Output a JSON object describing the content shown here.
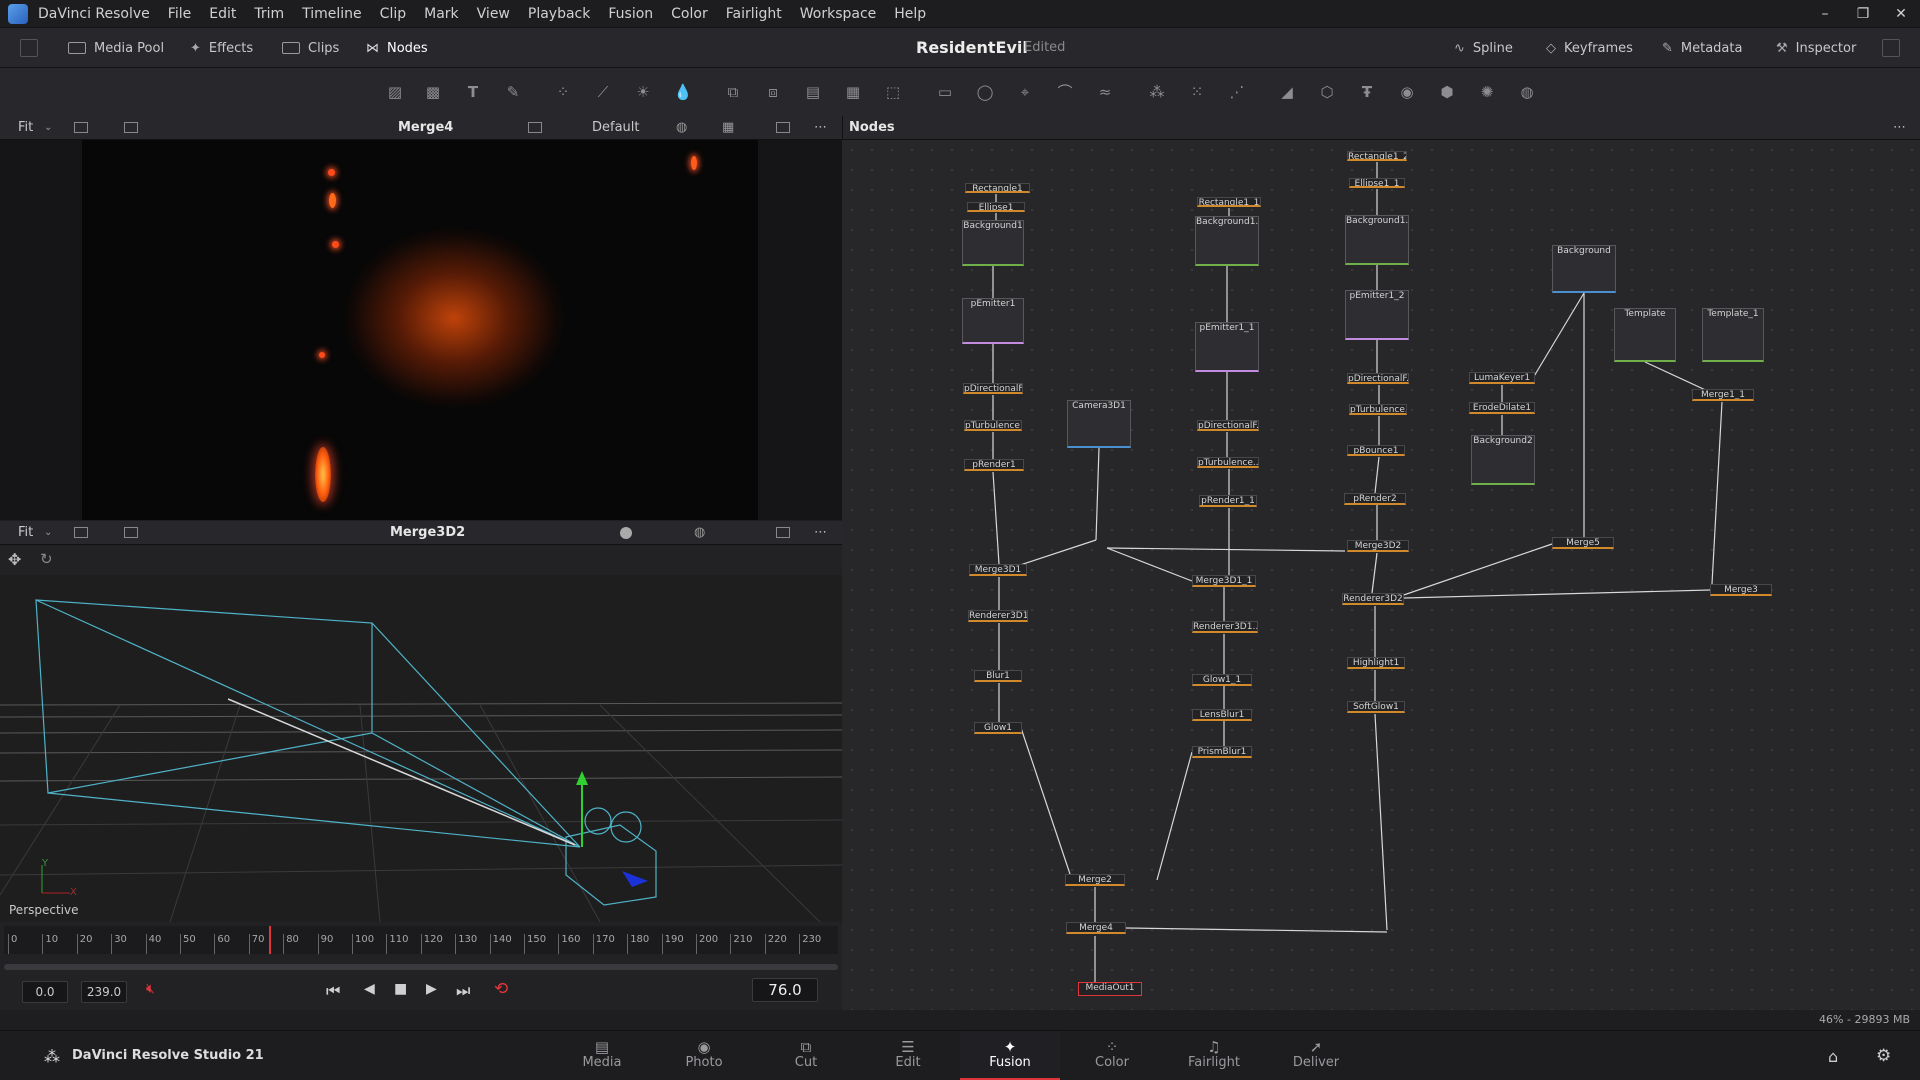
{
  "app": {
    "icon": "davinci-resolve-icon",
    "name": "DaVinci Resolve",
    "menus": [
      "File",
      "Edit",
      "Trim",
      "Timeline",
      "Clip",
      "Mark",
      "View",
      "Playback",
      "Fusion",
      "Color",
      "Fairlight",
      "Workspace",
      "Help"
    ]
  },
  "toolbar": {
    "left": [
      {
        "label": "Media Pool",
        "icon": "media-pool-icon"
      },
      {
        "label": "Effects",
        "icon": "effects-icon"
      },
      {
        "label": "Clips",
        "icon": "clips-icon"
      },
      {
        "label": "Nodes",
        "icon": "nodes-icon"
      }
    ],
    "project": "ResidentEvil",
    "status": "Edited",
    "right": [
      {
        "label": "Spline",
        "icon": "spline-icon"
      },
      {
        "label": "Keyframes",
        "icon": "keyframes-icon"
      },
      {
        "label": "Metadata",
        "icon": "metadata-icon"
      },
      {
        "label": "Inspector",
        "icon": "inspector-icon"
      }
    ]
  },
  "viewer1": {
    "zoom": "Fit",
    "title": "Merge4",
    "lut": "Default"
  },
  "viewer2": {
    "zoom": "Fit",
    "title": "Merge3D2",
    "mode": "Perspective",
    "axis_y": "Y",
    "axis_x": "X"
  },
  "nodes_panel": {
    "title": "Nodes",
    "memory": "46% - 29893 MB"
  },
  "node_list": [
    "Rectangle1",
    "Ellipse1",
    "Background1",
    "pEmitter1",
    "pDirectionalF...",
    "pTurbulence1",
    "pRender1",
    "Merge3D1",
    "Renderer3D1",
    "Blur1",
    "Glow1",
    "Camera3D1",
    "Rectangle1_1",
    "Background1...",
    "pEmitter1_1",
    "pDirectionalF...",
    "pTurbulence...",
    "pRender1_1",
    "Merge3D1_1",
    "Renderer3D1...",
    "Glow1_1",
    "LensBlur1",
    "PrismBlur1",
    "Rectangle1_2",
    "Ellipse1_1",
    "Background1...",
    "pEmitter1_2",
    "pDirectionalF...",
    "pTurbulence...",
    "pBounce1",
    "pRender2",
    "Merge3D2",
    "Renderer3D2",
    "Highlight1",
    "SoftGlow1",
    "Background",
    "LumaKeyer1",
    "ErodeDilate1",
    "Background2",
    "Merge5",
    "Template",
    "Template_1",
    "Merge1_1",
    "Merge3",
    "Merge2",
    "Merge4",
    "MediaOut1"
  ],
  "timeline": {
    "ticks": [
      "0",
      "10",
      "20",
      "30",
      "40",
      "50",
      "60",
      "70",
      "80",
      "90",
      "100",
      "110",
      "120",
      "130",
      "140",
      "150",
      "160",
      "170",
      "180",
      "190",
      "200",
      "210",
      "220",
      "230"
    ],
    "start": "0.0",
    "end": "239.0",
    "current": "76.0",
    "playhead_frame": 76,
    "last_frame": 239
  },
  "footer": {
    "product": "DaVinci Resolve Studio 21",
    "pages": [
      {
        "label": "Media",
        "icon": "media-page-icon"
      },
      {
        "label": "Photo",
        "icon": "photo-page-icon"
      },
      {
        "label": "Cut",
        "icon": "cut-page-icon"
      },
      {
        "label": "Edit",
        "icon": "edit-page-icon"
      },
      {
        "label": "Fusion",
        "icon": "fusion-page-icon",
        "active": true
      },
      {
        "label": "Color",
        "icon": "color-page-icon"
      },
      {
        "label": "Fairlight",
        "icon": "fairlight-page-icon"
      },
      {
        "label": "Deliver",
        "icon": "deliver-page-icon"
      }
    ]
  },
  "colors": {
    "accent": "#e0363b",
    "node_orange": "#d08a2b",
    "node_green": "#6fb04a",
    "wire": "#d8d8d8"
  }
}
